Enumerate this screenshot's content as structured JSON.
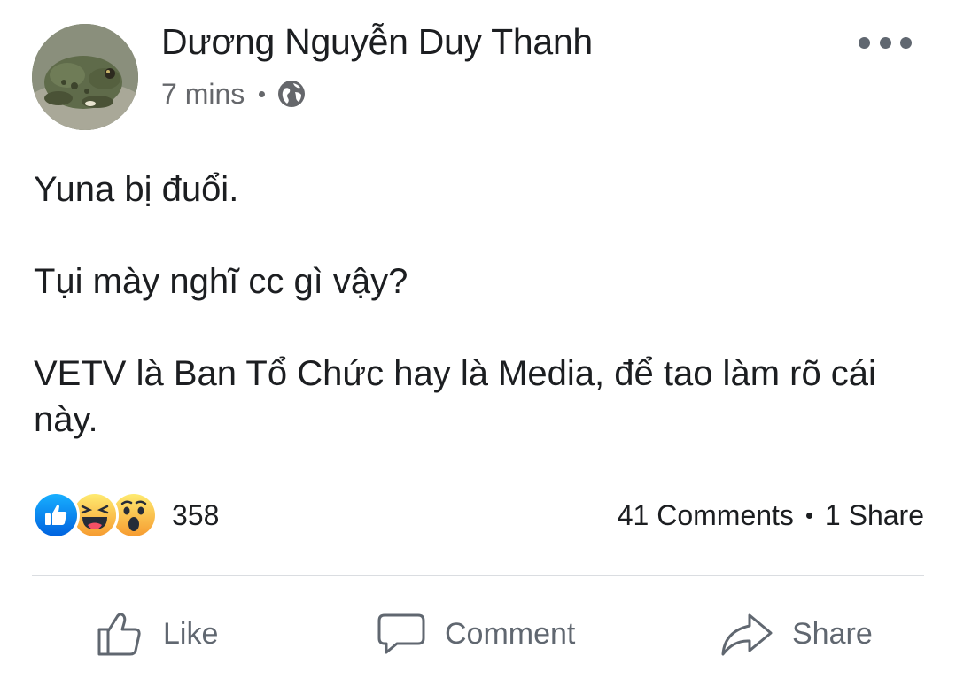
{
  "post": {
    "author": "Dương Nguyễn Duy Thanh",
    "time": "7 mins",
    "privacy_icon": "globe-icon",
    "avatar": "toad-avatar",
    "paragraphs": [
      "Yuna bị đuổi.",
      "Tụi mày nghĩ cc gì vậy?",
      "VETV là Ban Tổ Chức hay là Media, để tao làm rõ cái này."
    ]
  },
  "reactions": {
    "icons": [
      "like-reaction-icon",
      "haha-reaction-icon",
      "wow-reaction-icon"
    ],
    "count": "358"
  },
  "engagement": {
    "comments": "41 Comments",
    "shares": "1 Share"
  },
  "actions": {
    "like_label": "Like",
    "comment_label": "Comment",
    "share_label": "Share"
  },
  "colors": {
    "text": "#1c1e21",
    "muted": "#65676b",
    "like_blue": "#1877f2",
    "reaction_yellow": "#f7b125",
    "divider": "#dadde1"
  }
}
